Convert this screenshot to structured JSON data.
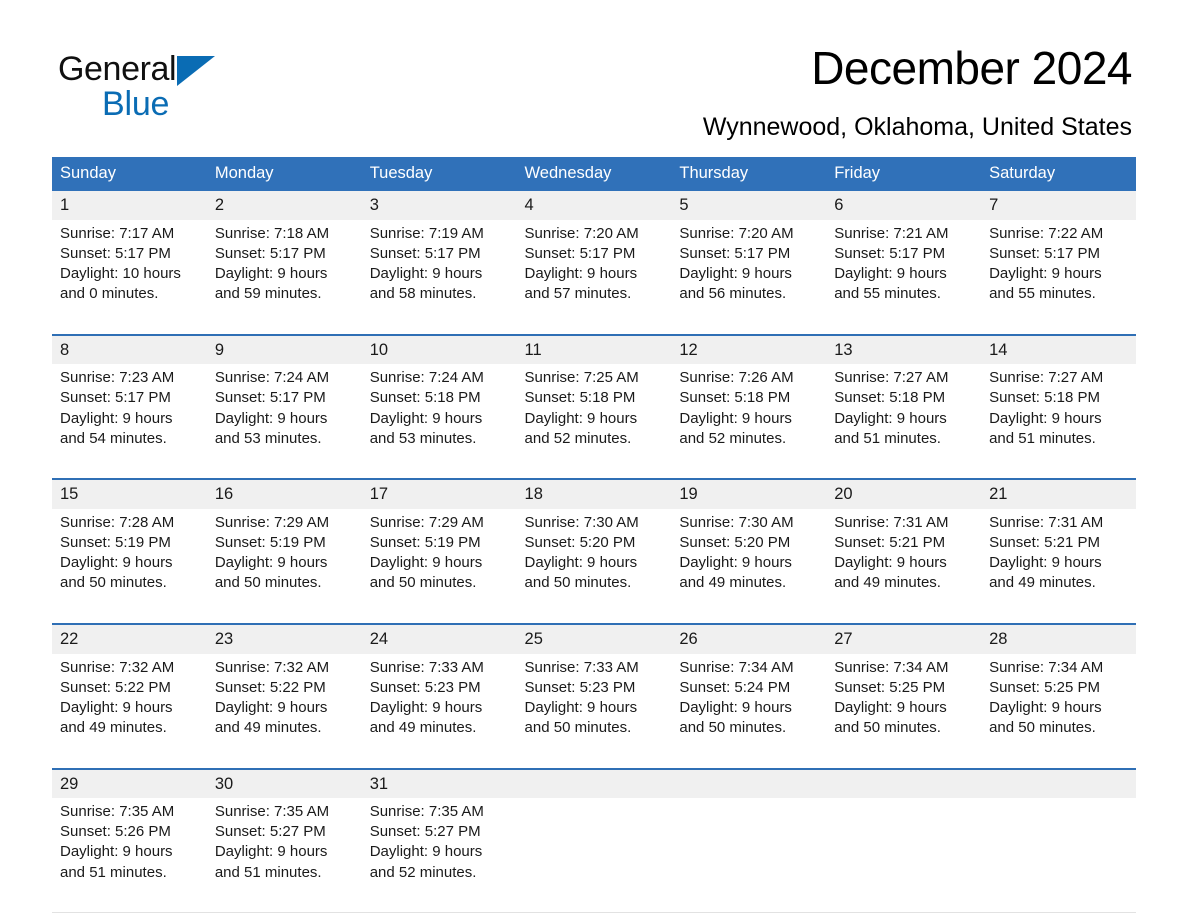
{
  "brand": {
    "word1": "General",
    "word2": "Blue",
    "logo_icon": "triangle-logo-icon",
    "accent_color": "#0a6cb4"
  },
  "header": {
    "month_title": "December 2024",
    "location": "Wynnewood, Oklahoma, United States"
  },
  "calendar": {
    "header_color": "#3071b9",
    "row_divider_color": "#2f6fb5",
    "daynum_band_color": "#f0f0f0",
    "weekday_headers": [
      "Sunday",
      "Monday",
      "Tuesday",
      "Wednesday",
      "Thursday",
      "Friday",
      "Saturday"
    ],
    "weeks": [
      [
        {
          "day": "1",
          "sunrise": "Sunrise: 7:17 AM",
          "sunset": "Sunset: 5:17 PM",
          "daylight1": "Daylight: 10 hours",
          "daylight2": "and 0 minutes."
        },
        {
          "day": "2",
          "sunrise": "Sunrise: 7:18 AM",
          "sunset": "Sunset: 5:17 PM",
          "daylight1": "Daylight: 9 hours",
          "daylight2": "and 59 minutes."
        },
        {
          "day": "3",
          "sunrise": "Sunrise: 7:19 AM",
          "sunset": "Sunset: 5:17 PM",
          "daylight1": "Daylight: 9 hours",
          "daylight2": "and 58 minutes."
        },
        {
          "day": "4",
          "sunrise": "Sunrise: 7:20 AM",
          "sunset": "Sunset: 5:17 PM",
          "daylight1": "Daylight: 9 hours",
          "daylight2": "and 57 minutes."
        },
        {
          "day": "5",
          "sunrise": "Sunrise: 7:20 AM",
          "sunset": "Sunset: 5:17 PM",
          "daylight1": "Daylight: 9 hours",
          "daylight2": "and 56 minutes."
        },
        {
          "day": "6",
          "sunrise": "Sunrise: 7:21 AM",
          "sunset": "Sunset: 5:17 PM",
          "daylight1": "Daylight: 9 hours",
          "daylight2": "and 55 minutes."
        },
        {
          "day": "7",
          "sunrise": "Sunrise: 7:22 AM",
          "sunset": "Sunset: 5:17 PM",
          "daylight1": "Daylight: 9 hours",
          "daylight2": "and 55 minutes."
        }
      ],
      [
        {
          "day": "8",
          "sunrise": "Sunrise: 7:23 AM",
          "sunset": "Sunset: 5:17 PM",
          "daylight1": "Daylight: 9 hours",
          "daylight2": "and 54 minutes."
        },
        {
          "day": "9",
          "sunrise": "Sunrise: 7:24 AM",
          "sunset": "Sunset: 5:17 PM",
          "daylight1": "Daylight: 9 hours",
          "daylight2": "and 53 minutes."
        },
        {
          "day": "10",
          "sunrise": "Sunrise: 7:24 AM",
          "sunset": "Sunset: 5:18 PM",
          "daylight1": "Daylight: 9 hours",
          "daylight2": "and 53 minutes."
        },
        {
          "day": "11",
          "sunrise": "Sunrise: 7:25 AM",
          "sunset": "Sunset: 5:18 PM",
          "daylight1": "Daylight: 9 hours",
          "daylight2": "and 52 minutes."
        },
        {
          "day": "12",
          "sunrise": "Sunrise: 7:26 AM",
          "sunset": "Sunset: 5:18 PM",
          "daylight1": "Daylight: 9 hours",
          "daylight2": "and 52 minutes."
        },
        {
          "day": "13",
          "sunrise": "Sunrise: 7:27 AM",
          "sunset": "Sunset: 5:18 PM",
          "daylight1": "Daylight: 9 hours",
          "daylight2": "and 51 minutes."
        },
        {
          "day": "14",
          "sunrise": "Sunrise: 7:27 AM",
          "sunset": "Sunset: 5:18 PM",
          "daylight1": "Daylight: 9 hours",
          "daylight2": "and 51 minutes."
        }
      ],
      [
        {
          "day": "15",
          "sunrise": "Sunrise: 7:28 AM",
          "sunset": "Sunset: 5:19 PM",
          "daylight1": "Daylight: 9 hours",
          "daylight2": "and 50 minutes."
        },
        {
          "day": "16",
          "sunrise": "Sunrise: 7:29 AM",
          "sunset": "Sunset: 5:19 PM",
          "daylight1": "Daylight: 9 hours",
          "daylight2": "and 50 minutes."
        },
        {
          "day": "17",
          "sunrise": "Sunrise: 7:29 AM",
          "sunset": "Sunset: 5:19 PM",
          "daylight1": "Daylight: 9 hours",
          "daylight2": "and 50 minutes."
        },
        {
          "day": "18",
          "sunrise": "Sunrise: 7:30 AM",
          "sunset": "Sunset: 5:20 PM",
          "daylight1": "Daylight: 9 hours",
          "daylight2": "and 50 minutes."
        },
        {
          "day": "19",
          "sunrise": "Sunrise: 7:30 AM",
          "sunset": "Sunset: 5:20 PM",
          "daylight1": "Daylight: 9 hours",
          "daylight2": "and 49 minutes."
        },
        {
          "day": "20",
          "sunrise": "Sunrise: 7:31 AM",
          "sunset": "Sunset: 5:21 PM",
          "daylight1": "Daylight: 9 hours",
          "daylight2": "and 49 minutes."
        },
        {
          "day": "21",
          "sunrise": "Sunrise: 7:31 AM",
          "sunset": "Sunset: 5:21 PM",
          "daylight1": "Daylight: 9 hours",
          "daylight2": "and 49 minutes."
        }
      ],
      [
        {
          "day": "22",
          "sunrise": "Sunrise: 7:32 AM",
          "sunset": "Sunset: 5:22 PM",
          "daylight1": "Daylight: 9 hours",
          "daylight2": "and 49 minutes."
        },
        {
          "day": "23",
          "sunrise": "Sunrise: 7:32 AM",
          "sunset": "Sunset: 5:22 PM",
          "daylight1": "Daylight: 9 hours",
          "daylight2": "and 49 minutes."
        },
        {
          "day": "24",
          "sunrise": "Sunrise: 7:33 AM",
          "sunset": "Sunset: 5:23 PM",
          "daylight1": "Daylight: 9 hours",
          "daylight2": "and 49 minutes."
        },
        {
          "day": "25",
          "sunrise": "Sunrise: 7:33 AM",
          "sunset": "Sunset: 5:23 PM",
          "daylight1": "Daylight: 9 hours",
          "daylight2": "and 50 minutes."
        },
        {
          "day": "26",
          "sunrise": "Sunrise: 7:34 AM",
          "sunset": "Sunset: 5:24 PM",
          "daylight1": "Daylight: 9 hours",
          "daylight2": "and 50 minutes."
        },
        {
          "day": "27",
          "sunrise": "Sunrise: 7:34 AM",
          "sunset": "Sunset: 5:25 PM",
          "daylight1": "Daylight: 9 hours",
          "daylight2": "and 50 minutes."
        },
        {
          "day": "28",
          "sunrise": "Sunrise: 7:34 AM",
          "sunset": "Sunset: 5:25 PM",
          "daylight1": "Daylight: 9 hours",
          "daylight2": "and 50 minutes."
        }
      ],
      [
        {
          "day": "29",
          "sunrise": "Sunrise: 7:35 AM",
          "sunset": "Sunset: 5:26 PM",
          "daylight1": "Daylight: 9 hours",
          "daylight2": "and 51 minutes."
        },
        {
          "day": "30",
          "sunrise": "Sunrise: 7:35 AM",
          "sunset": "Sunset: 5:27 PM",
          "daylight1": "Daylight: 9 hours",
          "daylight2": "and 51 minutes."
        },
        {
          "day": "31",
          "sunrise": "Sunrise: 7:35 AM",
          "sunset": "Sunset: 5:27 PM",
          "daylight1": "Daylight: 9 hours",
          "daylight2": "and 52 minutes."
        },
        {
          "day": "",
          "sunrise": "",
          "sunset": "",
          "daylight1": "",
          "daylight2": ""
        },
        {
          "day": "",
          "sunrise": "",
          "sunset": "",
          "daylight1": "",
          "daylight2": ""
        },
        {
          "day": "",
          "sunrise": "",
          "sunset": "",
          "daylight1": "",
          "daylight2": ""
        },
        {
          "day": "",
          "sunrise": "",
          "sunset": "",
          "daylight1": "",
          "daylight2": ""
        }
      ]
    ]
  }
}
